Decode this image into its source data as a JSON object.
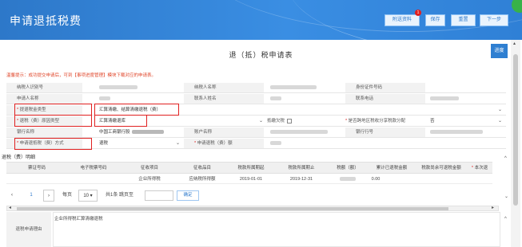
{
  "header": {
    "title": "申请退抵税费",
    "buttons": {
      "attachments": "附送资料",
      "save": "保存",
      "reset": "重置",
      "next": "下一步"
    },
    "attachment_badge": "1"
  },
  "progress_button": "进度",
  "form_title": "退（抵）税申请表",
  "notice": "温馨提示：成功提交申请后，可到【事项进度管理】模块下载对应的申请表。",
  "form": {
    "taxpayer_id_label": "纳税人识别号",
    "taxpayer_name_label": "纳税人名称",
    "id_number_label": "身份证件号码",
    "applicant_name_label": "申请人名称",
    "contact_name_label": "联系人姓名",
    "contact_phone_label": "联系电话",
    "refund_type_label": "提退税金类型",
    "refund_type_value": "汇算清缴、结算清缴退税（费）",
    "refund_reason_label": "退税（费）原因类型",
    "refund_reason_value": "汇算清缴退库",
    "offset_label": "抵缴欠税",
    "cross_region_label": "是否跨地区税收分享税款分配",
    "cross_region_value": "否",
    "bank_name_label": "银行名称",
    "bank_name_value": "中国工商银行股",
    "account_name_label": "账户名称",
    "bank_code_label": "银行行号",
    "refund_method_label": "申请退抵税（费）方式",
    "refund_method_value": "退税",
    "refund_amount_label": "申请退税（费）额"
  },
  "detail_title": "退税（费）明细",
  "table": {
    "columns": [
      "票证号码",
      "电子税票号码",
      "征收项目",
      "征收品目",
      "税款所属期起",
      "税款所属期止",
      "税额（额）",
      "累计已退税金额",
      "税款尚余可退税金额",
      "本次退"
    ],
    "rows": [
      [
        "",
        "",
        "企业所得税",
        "应纳税所得额",
        "2019-01-01",
        "2019-12-31",
        "",
        "0.00",
        "",
        ""
      ]
    ]
  },
  "pager": {
    "current_page": "1",
    "per_page_label": "每页",
    "per_page_value": "10",
    "total": "共1条 跳页至",
    "confirm": "确定"
  },
  "reason": {
    "label": "退税申请理由",
    "value": "企业所得税汇算清缴退税"
  }
}
